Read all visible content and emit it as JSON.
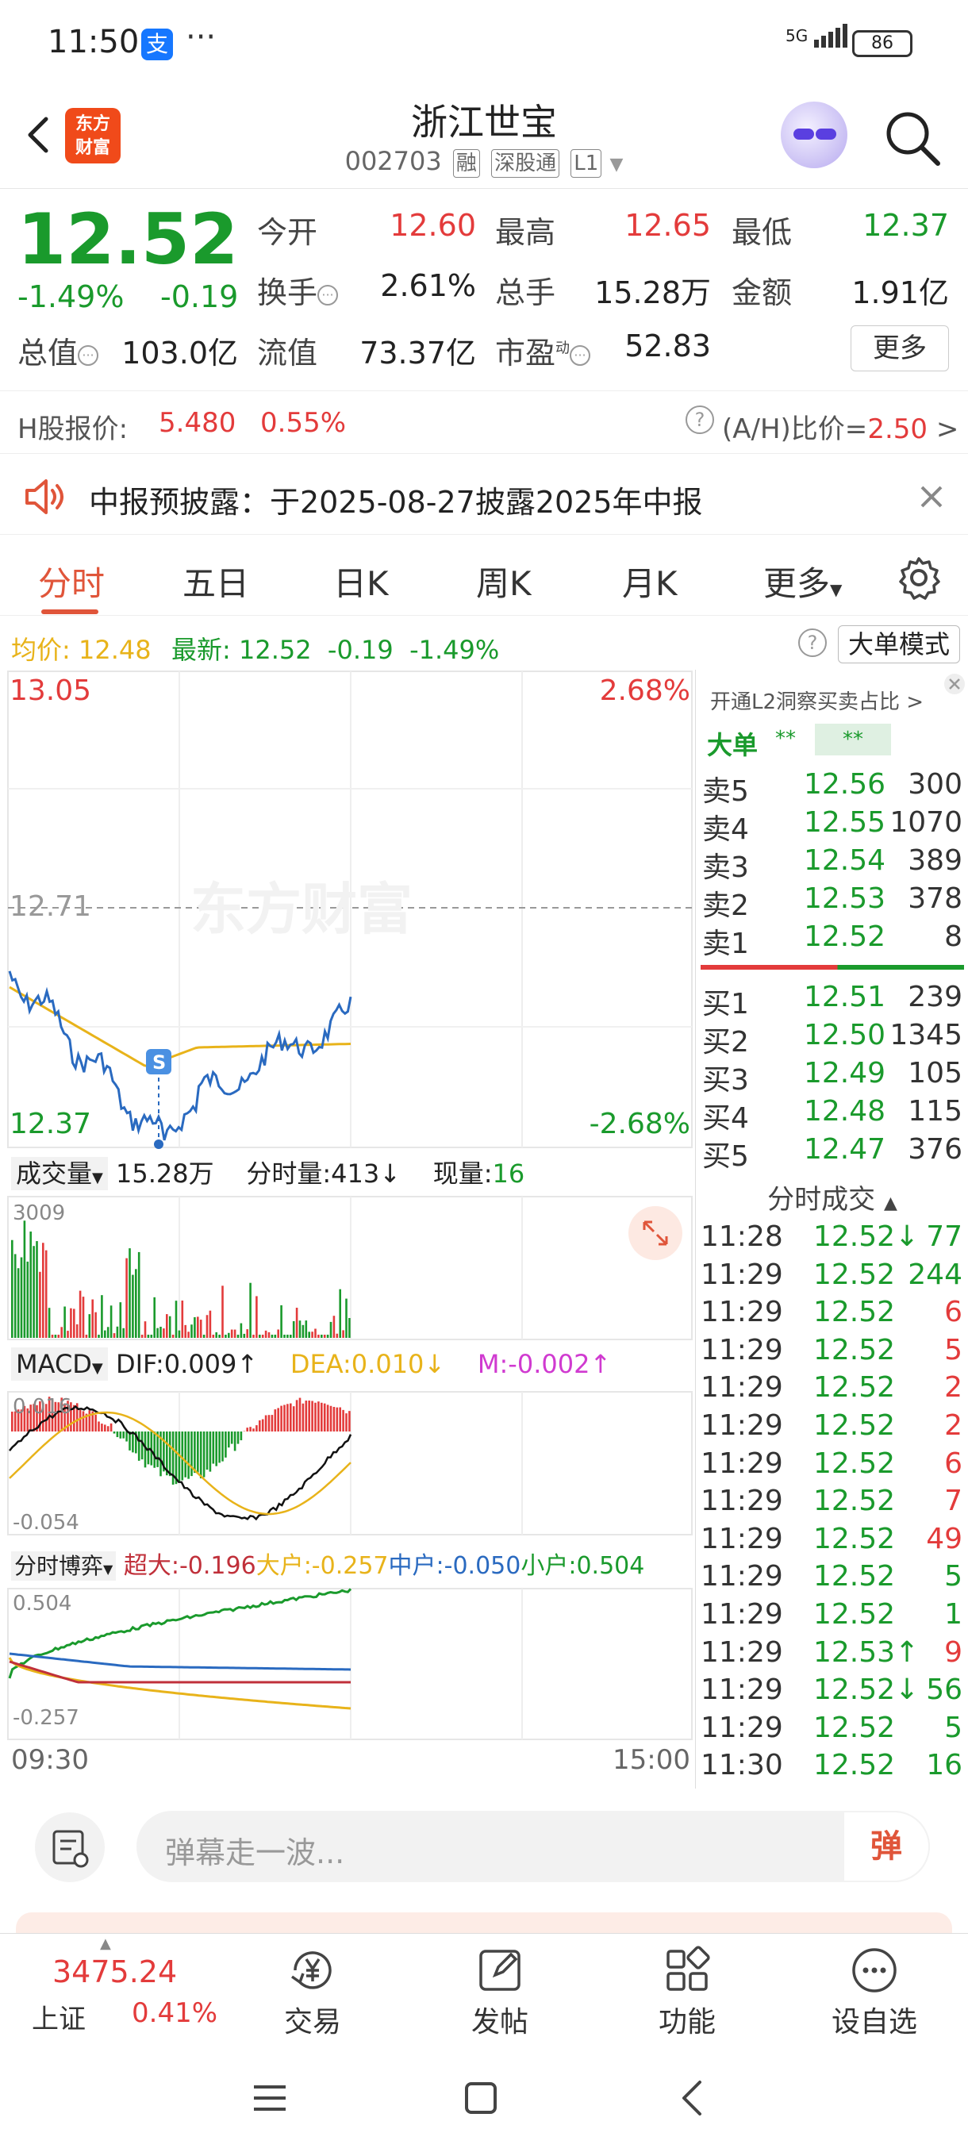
{
  "status_bar": {
    "time": "11:50",
    "network": "5G",
    "battery": "86"
  },
  "header": {
    "title": "浙江世宝",
    "code": "002703",
    "tags": [
      "融",
      "深股通",
      "L1"
    ],
    "brand": "东方财富"
  },
  "quote": {
    "price": "12.52",
    "change_pct": "-1.49%",
    "change": "-0.19",
    "fields": [
      {
        "label": "今开",
        "value": "12.60",
        "color": "red"
      },
      {
        "label": "最高",
        "value": "12.65",
        "color": "red"
      },
      {
        "label": "最低",
        "value": "12.37",
        "color": "green"
      },
      {
        "label": "换手",
        "value": "2.61%",
        "color": "dark"
      },
      {
        "label": "总手",
        "value": "15.28万",
        "color": "dark"
      },
      {
        "label": "金额",
        "value": "1.91亿",
        "color": "dark"
      },
      {
        "label": "总值",
        "value": "103.0亿",
        "color": "dark"
      },
      {
        "label": "流值",
        "value": "73.37亿",
        "color": "dark"
      },
      {
        "label": "市盈",
        "value": "52.83",
        "color": "dark"
      }
    ],
    "pe_superscript": "动",
    "more_label": "更多"
  },
  "h_share": {
    "label": "H股报价:",
    "price": "5.480",
    "pct": "0.55%",
    "ratio_label": "(A/H)比价=",
    "ratio_value": "2.50",
    "arrow": ">"
  },
  "notice": {
    "text": "中报预披露：于2025-08-27披露2025年中报"
  },
  "tabs": [
    "分时",
    "五日",
    "日K",
    "周K",
    "月K",
    "更多"
  ],
  "avg_bar": {
    "avg_label": "均价:",
    "avg_value": "12.48",
    "latest_label": "最新:",
    "latest_value": "12.52",
    "change": "-0.19",
    "pct": "-1.49%",
    "big_order_label": "大单模式"
  },
  "chart": {
    "high": "13.05",
    "high_pct": "2.68%",
    "mid": "12.71",
    "low": "12.37",
    "low_pct": "-2.68%",
    "watermark": "东方财富",
    "marker": "S",
    "volume": {
      "label": "成交量",
      "total": "15.28万",
      "fenshi_label": "分时量:",
      "fenshi_value": "413",
      "fenshi_arrow": "↓",
      "now_label": "现量:",
      "now_value": "16",
      "ymax": "3009"
    },
    "macd": {
      "label": "MACD",
      "dif": "DIF:0.009",
      "dif_arrow": "↑",
      "dea": "DEA:0.010",
      "dea_arrow": "↓",
      "m": "M:-0.002",
      "m_arrow": "↑",
      "ymax": "0.016",
      "ymin": "-0.054"
    },
    "game": {
      "label": "分时博弈",
      "super": "超大:-0.196",
      "big": "大户:-0.257",
      "mid": "中户:-0.050",
      "small": "小户:0.504",
      "ymax": "0.504",
      "ymin": "-0.257"
    },
    "time_start": "09:30",
    "time_end": "15:00"
  },
  "orderbook": {
    "header": "开通L2洞察买卖占比",
    "header_arrow": ">",
    "big_label": "大单",
    "masked1": "**",
    "masked2": "**",
    "sells": [
      {
        "label": "卖5",
        "price": "12.56",
        "vol": "300"
      },
      {
        "label": "卖4",
        "price": "12.55",
        "vol": "1070"
      },
      {
        "label": "卖3",
        "price": "12.54",
        "vol": "389"
      },
      {
        "label": "卖2",
        "price": "12.53",
        "vol": "378"
      },
      {
        "label": "卖1",
        "price": "12.52",
        "vol": "8"
      }
    ],
    "buys": [
      {
        "label": "买1",
        "price": "12.51",
        "vol": "239"
      },
      {
        "label": "买2",
        "price": "12.50",
        "vol": "1345"
      },
      {
        "label": "买3",
        "price": "12.49",
        "vol": "105"
      },
      {
        "label": "买4",
        "price": "12.48",
        "vol": "115"
      },
      {
        "label": "买5",
        "price": "12.47",
        "vol": "376"
      }
    ],
    "trades_header": "分时成交",
    "trades": [
      {
        "time": "11:28",
        "price": "12.52↓",
        "vol": "77",
        "pc": "green",
        "vc": "green"
      },
      {
        "time": "11:29",
        "price": "12.52",
        "vol": "244",
        "pc": "green",
        "vc": "green"
      },
      {
        "time": "11:29",
        "price": "12.52",
        "vol": "6",
        "pc": "green",
        "vc": "red"
      },
      {
        "time": "11:29",
        "price": "12.52",
        "vol": "5",
        "pc": "green",
        "vc": "red"
      },
      {
        "time": "11:29",
        "price": "12.52",
        "vol": "2",
        "pc": "green",
        "vc": "red"
      },
      {
        "time": "11:29",
        "price": "12.52",
        "vol": "2",
        "pc": "green",
        "vc": "red"
      },
      {
        "time": "11:29",
        "price": "12.52",
        "vol": "6",
        "pc": "green",
        "vc": "red"
      },
      {
        "time": "11:29",
        "price": "12.52",
        "vol": "7",
        "pc": "green",
        "vc": "red"
      },
      {
        "time": "11:29",
        "price": "12.52",
        "vol": "49",
        "pc": "green",
        "vc": "red"
      },
      {
        "time": "11:29",
        "price": "12.52",
        "vol": "5",
        "pc": "green",
        "vc": "green"
      },
      {
        "time": "11:29",
        "price": "12.52",
        "vol": "1",
        "pc": "green",
        "vc": "green"
      },
      {
        "time": "11:29",
        "price": "12.53↑",
        "vol": "9",
        "pc": "green",
        "vc": "red"
      },
      {
        "time": "11:29",
        "price": "12.52↓",
        "vol": "56",
        "pc": "green",
        "vc": "green"
      },
      {
        "time": "11:29",
        "price": "12.52",
        "vol": "5",
        "pc": "green",
        "vc": "green"
      },
      {
        "time": "11:30",
        "price": "12.52",
        "vol": "16",
        "pc": "green",
        "vc": "green"
      }
    ]
  },
  "comment": {
    "placeholder": "弹幕走一波...",
    "danmu_label": "弹"
  },
  "bottom_nav": {
    "index_value": "3475.24",
    "index_name": "上证",
    "index_pct": "0.41%",
    "items": [
      "交易",
      "发帖",
      "功能",
      "设自选"
    ]
  },
  "colors": {
    "up": "#e33b3b",
    "down": "#1a9a2c",
    "accent": "#e0553a",
    "price_line": "#2a6ac0",
    "avg_line": "#e8b31a"
  }
}
